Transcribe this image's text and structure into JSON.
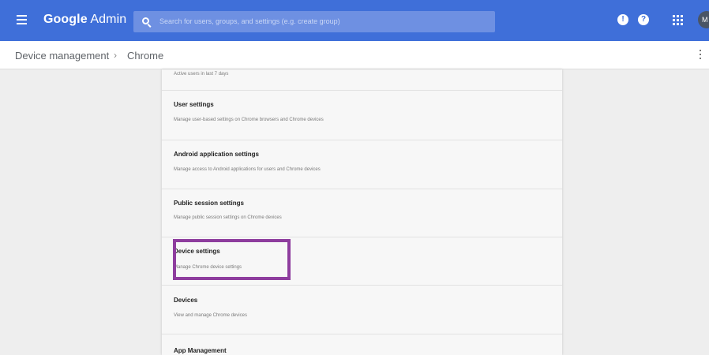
{
  "header": {
    "brand_bold": "Google",
    "brand_rest": " Admin",
    "search_placeholder": "Search for users, groups, and settings (e.g. create group)",
    "notification_glyph": "!",
    "help_glyph": "?",
    "avatar_initial": "M",
    "icons": [
      "menu-icon",
      "search-icon",
      "notifications-icon",
      "help-icon",
      "apps-icon"
    ],
    "bar_color": "#3f6fd9"
  },
  "breadcrumb": {
    "items": [
      "Device management",
      "Chrome"
    ],
    "separator": "›"
  },
  "sections": [
    {
      "title": "",
      "description": "Active users in last 7 days"
    },
    {
      "title": "User settings",
      "description": "Manage user-based settings on Chrome browsers and Chrome devices"
    },
    {
      "title": "Android application settings",
      "description": "Manage access to Android applications for users and Chrome devices"
    },
    {
      "title": "Public session settings",
      "description": "Manage public session settings on Chrome devices"
    },
    {
      "title": "Device settings",
      "description": "Manage Chrome device settings"
    },
    {
      "title": "Devices",
      "description": "View and manage Chrome devices"
    },
    {
      "title": "App Management",
      "description": ""
    }
  ],
  "highlight": {
    "target": "Device settings",
    "color": "#8e3d9e"
  }
}
